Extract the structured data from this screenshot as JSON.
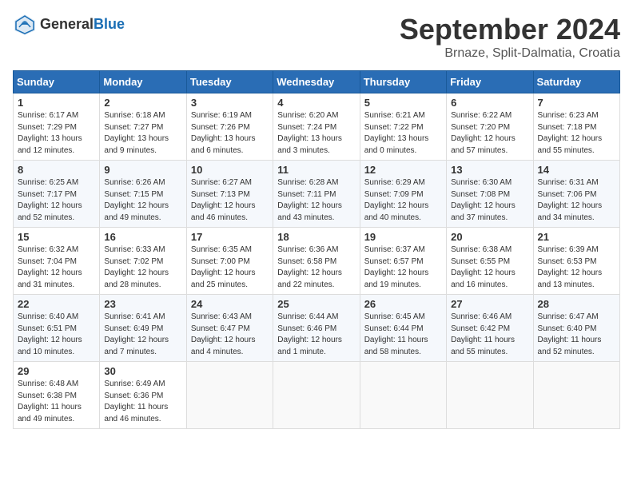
{
  "header": {
    "logo_general": "General",
    "logo_blue": "Blue",
    "month": "September 2024",
    "location": "Brnaze, Split-Dalmatia, Croatia"
  },
  "weekdays": [
    "Sunday",
    "Monday",
    "Tuesday",
    "Wednesday",
    "Thursday",
    "Friday",
    "Saturday"
  ],
  "weeks": [
    [
      {
        "day": "1",
        "sunrise": "Sunrise: 6:17 AM",
        "sunset": "Sunset: 7:29 PM",
        "daylight": "Daylight: 13 hours and 12 minutes."
      },
      {
        "day": "2",
        "sunrise": "Sunrise: 6:18 AM",
        "sunset": "Sunset: 7:27 PM",
        "daylight": "Daylight: 13 hours and 9 minutes."
      },
      {
        "day": "3",
        "sunrise": "Sunrise: 6:19 AM",
        "sunset": "Sunset: 7:26 PM",
        "daylight": "Daylight: 13 hours and 6 minutes."
      },
      {
        "day": "4",
        "sunrise": "Sunrise: 6:20 AM",
        "sunset": "Sunset: 7:24 PM",
        "daylight": "Daylight: 13 hours and 3 minutes."
      },
      {
        "day": "5",
        "sunrise": "Sunrise: 6:21 AM",
        "sunset": "Sunset: 7:22 PM",
        "daylight": "Daylight: 13 hours and 0 minutes."
      },
      {
        "day": "6",
        "sunrise": "Sunrise: 6:22 AM",
        "sunset": "Sunset: 7:20 PM",
        "daylight": "Daylight: 12 hours and 57 minutes."
      },
      {
        "day": "7",
        "sunrise": "Sunrise: 6:23 AM",
        "sunset": "Sunset: 7:18 PM",
        "daylight": "Daylight: 12 hours and 55 minutes."
      }
    ],
    [
      {
        "day": "8",
        "sunrise": "Sunrise: 6:25 AM",
        "sunset": "Sunset: 7:17 PM",
        "daylight": "Daylight: 12 hours and 52 minutes."
      },
      {
        "day": "9",
        "sunrise": "Sunrise: 6:26 AM",
        "sunset": "Sunset: 7:15 PM",
        "daylight": "Daylight: 12 hours and 49 minutes."
      },
      {
        "day": "10",
        "sunrise": "Sunrise: 6:27 AM",
        "sunset": "Sunset: 7:13 PM",
        "daylight": "Daylight: 12 hours and 46 minutes."
      },
      {
        "day": "11",
        "sunrise": "Sunrise: 6:28 AM",
        "sunset": "Sunset: 7:11 PM",
        "daylight": "Daylight: 12 hours and 43 minutes."
      },
      {
        "day": "12",
        "sunrise": "Sunrise: 6:29 AM",
        "sunset": "Sunset: 7:09 PM",
        "daylight": "Daylight: 12 hours and 40 minutes."
      },
      {
        "day": "13",
        "sunrise": "Sunrise: 6:30 AM",
        "sunset": "Sunset: 7:08 PM",
        "daylight": "Daylight: 12 hours and 37 minutes."
      },
      {
        "day": "14",
        "sunrise": "Sunrise: 6:31 AM",
        "sunset": "Sunset: 7:06 PM",
        "daylight": "Daylight: 12 hours and 34 minutes."
      }
    ],
    [
      {
        "day": "15",
        "sunrise": "Sunrise: 6:32 AM",
        "sunset": "Sunset: 7:04 PM",
        "daylight": "Daylight: 12 hours and 31 minutes."
      },
      {
        "day": "16",
        "sunrise": "Sunrise: 6:33 AM",
        "sunset": "Sunset: 7:02 PM",
        "daylight": "Daylight: 12 hours and 28 minutes."
      },
      {
        "day": "17",
        "sunrise": "Sunrise: 6:35 AM",
        "sunset": "Sunset: 7:00 PM",
        "daylight": "Daylight: 12 hours and 25 minutes."
      },
      {
        "day": "18",
        "sunrise": "Sunrise: 6:36 AM",
        "sunset": "Sunset: 6:58 PM",
        "daylight": "Daylight: 12 hours and 22 minutes."
      },
      {
        "day": "19",
        "sunrise": "Sunrise: 6:37 AM",
        "sunset": "Sunset: 6:57 PM",
        "daylight": "Daylight: 12 hours and 19 minutes."
      },
      {
        "day": "20",
        "sunrise": "Sunrise: 6:38 AM",
        "sunset": "Sunset: 6:55 PM",
        "daylight": "Daylight: 12 hours and 16 minutes."
      },
      {
        "day": "21",
        "sunrise": "Sunrise: 6:39 AM",
        "sunset": "Sunset: 6:53 PM",
        "daylight": "Daylight: 12 hours and 13 minutes."
      }
    ],
    [
      {
        "day": "22",
        "sunrise": "Sunrise: 6:40 AM",
        "sunset": "Sunset: 6:51 PM",
        "daylight": "Daylight: 12 hours and 10 minutes."
      },
      {
        "day": "23",
        "sunrise": "Sunrise: 6:41 AM",
        "sunset": "Sunset: 6:49 PM",
        "daylight": "Daylight: 12 hours and 7 minutes."
      },
      {
        "day": "24",
        "sunrise": "Sunrise: 6:43 AM",
        "sunset": "Sunset: 6:47 PM",
        "daylight": "Daylight: 12 hours and 4 minutes."
      },
      {
        "day": "25",
        "sunrise": "Sunrise: 6:44 AM",
        "sunset": "Sunset: 6:46 PM",
        "daylight": "Daylight: 12 hours and 1 minute."
      },
      {
        "day": "26",
        "sunrise": "Sunrise: 6:45 AM",
        "sunset": "Sunset: 6:44 PM",
        "daylight": "Daylight: 11 hours and 58 minutes."
      },
      {
        "day": "27",
        "sunrise": "Sunrise: 6:46 AM",
        "sunset": "Sunset: 6:42 PM",
        "daylight": "Daylight: 11 hours and 55 minutes."
      },
      {
        "day": "28",
        "sunrise": "Sunrise: 6:47 AM",
        "sunset": "Sunset: 6:40 PM",
        "daylight": "Daylight: 11 hours and 52 minutes."
      }
    ],
    [
      {
        "day": "29",
        "sunrise": "Sunrise: 6:48 AM",
        "sunset": "Sunset: 6:38 PM",
        "daylight": "Daylight: 11 hours and 49 minutes."
      },
      {
        "day": "30",
        "sunrise": "Sunrise: 6:49 AM",
        "sunset": "Sunset: 6:36 PM",
        "daylight": "Daylight: 11 hours and 46 minutes."
      },
      null,
      null,
      null,
      null,
      null
    ]
  ]
}
